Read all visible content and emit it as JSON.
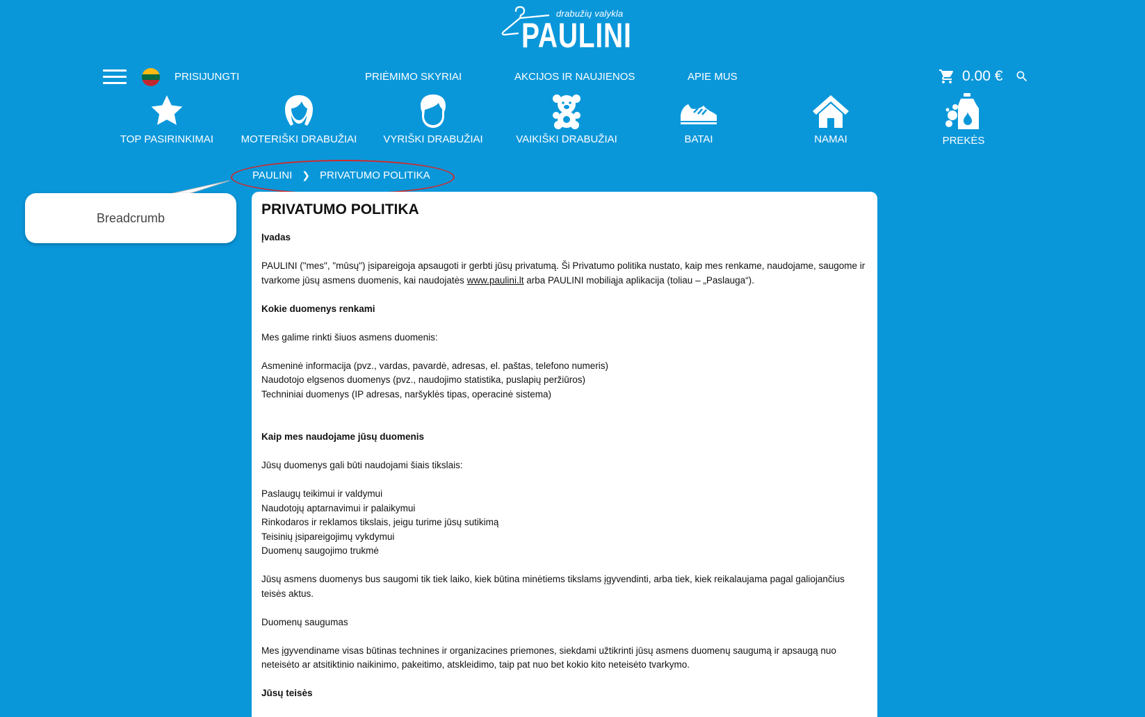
{
  "logo": {
    "tagline": "drabužių valykla",
    "name": "PAULINI"
  },
  "topbar": {
    "login": "PRISIJUNGTI",
    "nav": [
      "PRIĖMIMO SKYRIAI",
      "AKCIJOS IR NAUJIENOS",
      "APIE MUS"
    ],
    "cart_total": "0.00 €"
  },
  "categories": [
    {
      "label": "TOP PASIRINKIMAI",
      "icon": "star-icon"
    },
    {
      "label": "MOTERIŠKI DRABUŽIAI",
      "icon": "woman-icon"
    },
    {
      "label": "VYRIŠKI DRABUŽIAI",
      "icon": "man-icon"
    },
    {
      "label": "VAIKIŠKI DRABUŽIAI",
      "icon": "teddy-bear-icon"
    },
    {
      "label": "BATAI",
      "icon": "shoe-icon"
    },
    {
      "label": "NAMAI",
      "icon": "house-icon"
    },
    {
      "label": "PREKĖS",
      "icon": "detergent-icon"
    }
  ],
  "breadcrumb": {
    "home": "PAULINI",
    "current": "PRIVATUMO POLITIKA"
  },
  "callout": "Breadcrumb",
  "colors": {
    "background": "#0a97da",
    "oval": "#d02a2a",
    "flag_yellow": "#fdb913",
    "flag_green": "#006a44",
    "flag_red": "#c1272d"
  },
  "page": {
    "title": "PRIVATUMO POLITIKA",
    "intro_heading": "Įvadas",
    "intro_text_1": "PAULINI (\"mes\", \"mūsų\") įsipareigoja apsaugoti ir gerbti jūsų privatumą. Ši Privatumo politika nustato, kaip mes renkame, naudojame, saugome ir tvarkome jūsų asmens duomenis, kai naudojatės ",
    "intro_link": "www.paulini.lt",
    "intro_text_2": " arba PAULINI mobiliąja aplikacija (toliau – „Paslauga“).",
    "collected_heading": "Kokie duomenys renkami",
    "collected_lead": "Mes galime rinkti šiuos asmens duomenis:",
    "collected_items": [
      "Asmeninė informacija (pvz., vardas, pavardė, adresas, el. paštas, telefono numeris)",
      "Naudotojo elgsenos duomenys (pvz., naudojimo statistika, puslapių peržiūros)",
      "Techniniai duomenys (IP adresas, naršyklės tipas, operacinė sistema)"
    ],
    "usage_heading": "Kaip mes naudojame jūsų duomenis",
    "usage_lead": "Jūsų duomenys gali būti naudojami šiais tikslais:",
    "usage_items": [
      "Paslaugų teikimui ir valdymui",
      "Naudotojų aptarnavimui ir palaikymui",
      "Rinkodaros ir reklamos tikslais, jeigu turime jūsų sutikimą",
      "Teisinių įsipareigojimų vykdymui",
      "Duomenų saugojimo trukmė"
    ],
    "retention_text": "Jūsų asmens duomenys bus saugomi tik tiek laiko, kiek būtina minėtiems tikslams įgyvendinti, arba tiek, kiek reikalaujama pagal galiojančius teisės aktus.",
    "security_heading": "Duomenų saugumas",
    "security_text": "Mes įgyvendiname visas būtinas technines ir organizacines priemones, siekdami užtikrinti jūsų asmens duomenų saugumą ir apsaugą nuo neteisėto ar atsitiktinio naikinimo, pakeitimo, atskleidimo, taip pat nuo bet kokio kito neteisėto tvarkymo.",
    "rights_heading": "Jūsų teisės"
  }
}
